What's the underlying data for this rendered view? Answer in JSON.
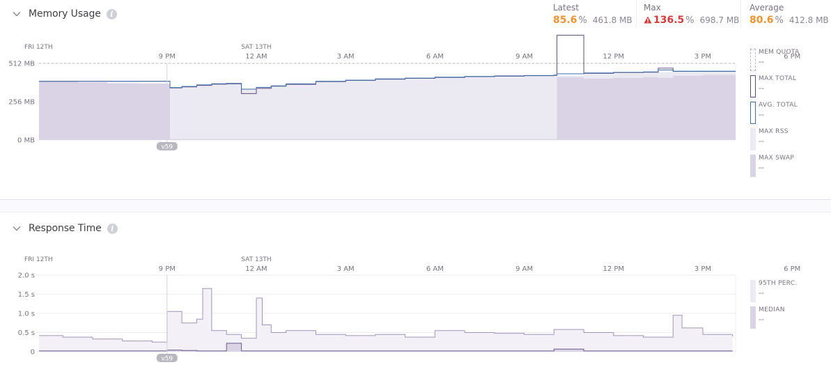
{
  "colors": {
    "latest": "#f2922e",
    "max": "#d63a3a",
    "average": "#f2922e",
    "avg_line": "#3a6fb0",
    "max_total_line": "#5c4a7a",
    "rss_fill": "#ebe9f2",
    "swap_fill": "#dad3e6",
    "quota": "#b7b4bc",
    "median": "#6b5b86",
    "p95": "#a294b8"
  },
  "memory": {
    "title": "Memory Usage",
    "info_icon": "info-icon",
    "collapse_icon": "chevron-down-icon",
    "stats": {
      "latest": {
        "label": "Latest",
        "value": "85.6",
        "unit": "%",
        "mb": "461.8 MB"
      },
      "max": {
        "label": "Max",
        "value": "136.5",
        "unit": "%",
        "mb": "698.7 MB",
        "icon": "warning-icon"
      },
      "average": {
        "label": "Average",
        "value": "80.6",
        "unit": "%",
        "mb": "412.8 MB"
      }
    },
    "legend": [
      {
        "key": "quota",
        "label": "MEM QUOTA",
        "value": "--"
      },
      {
        "key": "max_total",
        "label": "MAX TOTAL",
        "value": "--"
      },
      {
        "key": "avg_total",
        "label": "AVG. TOTAL",
        "value": "--"
      },
      {
        "key": "max_rss",
        "label": "MAX RSS",
        "value": "--"
      },
      {
        "key": "max_swap",
        "label": "MAX SWAP",
        "value": "--"
      }
    ]
  },
  "response": {
    "title": "Response Time",
    "info_icon": "info-icon",
    "collapse_icon": "chevron-down-icon",
    "legend": [
      {
        "key": "p95",
        "label": "95TH PERC.",
        "value": "--"
      },
      {
        "key": "median",
        "label": "MEDIAN",
        "value": "--"
      }
    ]
  },
  "time_axis": {
    "day_labels": [
      "FRI 12TH",
      "SAT 13TH"
    ],
    "ticks": [
      "9 PM",
      "12 AM",
      "3 AM",
      "6 AM",
      "9 AM",
      "12 PM",
      "3 PM",
      "6 PM"
    ],
    "release_badge": "v59"
  },
  "chart_data": [
    {
      "type": "area",
      "title": "Memory Usage",
      "y_tick_labels": [
        "512 MB",
        "256 MB",
        "0 MB"
      ],
      "ylim": [
        0,
        512
      ],
      "x_range_hours": [
        -4.3,
        19.1
      ],
      "x": [
        -4.3,
        -3.0,
        -2.0,
        -1.0,
        0.0,
        0.1,
        0.5,
        1.0,
        1.5,
        2.0,
        2.5,
        3.0,
        3.5,
        4.0,
        5.0,
        6.0,
        7.0,
        8.0,
        9.0,
        10.0,
        11.0,
        12.0,
        13.0,
        13.1,
        14.0,
        15.0,
        16.0,
        16.5,
        17.0,
        18.0,
        19.1
      ],
      "series": [
        {
          "name": "MEM QUOTA",
          "values": [
            512,
            512,
            512,
            512,
            512,
            512,
            512,
            512,
            512,
            512,
            512,
            512,
            512,
            512,
            512,
            512,
            512,
            512,
            512,
            512,
            512,
            512,
            512,
            512,
            512,
            512,
            512,
            512,
            512,
            512,
            512
          ]
        },
        {
          "name": "AVG. TOTAL",
          "values": [
            392,
            392,
            392,
            392,
            392,
            350,
            358,
            368,
            376,
            378,
            340,
            352,
            362,
            375,
            392,
            400,
            408,
            414,
            420,
            425,
            428,
            431,
            434,
            442,
            448,
            452,
            455,
            468,
            460,
            460,
            460
          ]
        },
        {
          "name": "MAX TOTAL",
          "values": [
            392,
            392,
            392,
            392,
            392,
            348,
            355,
            365,
            373,
            375,
            310,
            345,
            360,
            372,
            390,
            398,
            406,
            412,
            418,
            423,
            426,
            429,
            432,
            700,
            445,
            450,
            453,
            480,
            458,
            458,
            458
          ]
        },
        {
          "name": "MAX RSS",
          "values": [
            380,
            375,
            372,
            370,
            368,
            350,
            356,
            366,
            372,
            374,
            338,
            350,
            360,
            372,
            388,
            396,
            404,
            410,
            414,
            418,
            420,
            424,
            428,
            430,
            440,
            444,
            448,
            452,
            452,
            452,
            452
          ]
        },
        {
          "name": "MAX SWAP",
          "values": [
            390,
            385,
            380,
            378,
            376,
            6,
            6,
            6,
            6,
            6,
            6,
            6,
            6,
            6,
            6,
            6,
            6,
            6,
            6,
            6,
            6,
            6,
            6,
            420,
            410,
            415,
            420,
            415,
            430,
            435,
            440
          ]
        }
      ]
    },
    {
      "type": "area",
      "title": "Response Time",
      "y_tick_labels": [
        "2.0 s",
        "1.5 s",
        "1.0 s",
        "0.5 s",
        "0"
      ],
      "ylim": [
        0,
        2.0
      ],
      "x_range_hours": [
        -4.3,
        19.1
      ],
      "x": [
        -4.3,
        -3.5,
        -2.5,
        -1.5,
        -0.5,
        0.0,
        0.5,
        1.0,
        1.2,
        1.5,
        2.0,
        2.5,
        3.0,
        3.2,
        3.5,
        4.0,
        5.0,
        6.0,
        7.0,
        8.0,
        9.0,
        10.0,
        11.0,
        12.0,
        13.0,
        14.0,
        15.0,
        16.0,
        17.0,
        17.3,
        18.0,
        19.0
      ],
      "series": [
        {
          "name": "95TH PERC.",
          "values": [
            0.42,
            0.38,
            0.33,
            0.28,
            0.25,
            1.05,
            0.75,
            0.85,
            1.65,
            0.55,
            0.45,
            0.35,
            1.4,
            0.7,
            0.5,
            0.55,
            0.45,
            0.42,
            0.45,
            0.38,
            0.55,
            0.5,
            0.48,
            0.45,
            0.58,
            0.5,
            0.42,
            0.38,
            0.95,
            0.62,
            0.45,
            0.4
          ]
        },
        {
          "name": "MEDIAN",
          "values": [
            0.02,
            0.02,
            0.02,
            0.02,
            0.02,
            0.04,
            0.03,
            0.02,
            0.02,
            0.02,
            0.22,
            0.02,
            0.02,
            0.02,
            0.02,
            0.02,
            0.02,
            0.02,
            0.02,
            0.02,
            0.02,
            0.02,
            0.02,
            0.02,
            0.07,
            0.02,
            0.02,
            0.02,
            0.02,
            0.02,
            0.02,
            0.02
          ]
        }
      ]
    }
  ]
}
